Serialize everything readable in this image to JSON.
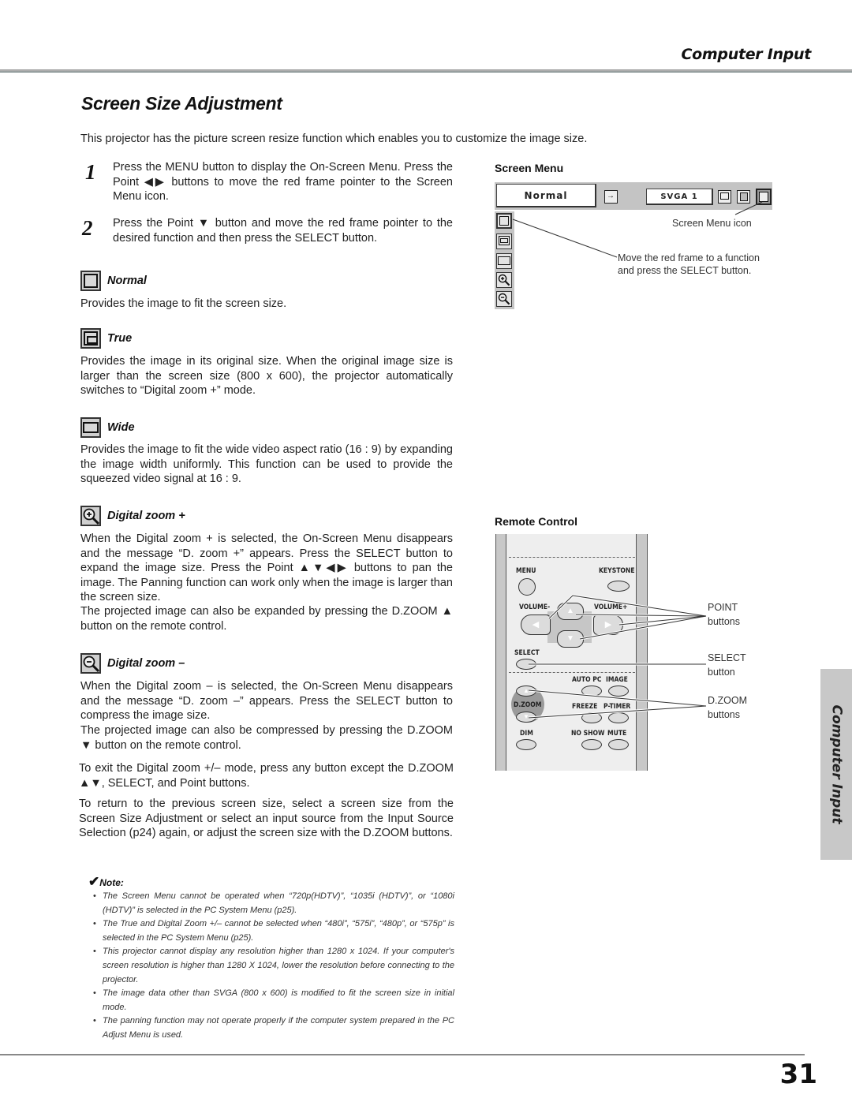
{
  "header": {
    "section": "Computer Input"
  },
  "page": {
    "title": "Screen Size Adjustment",
    "number": "31"
  },
  "intro": "This projector has the picture screen resize function which enables you to customize the image size.",
  "steps": [
    {
      "num": "1",
      "text": "Press the MENU button to display the On-Screen Menu. Press the Point ◀▶ buttons to move the red frame pointer to the Screen Menu icon."
    },
    {
      "num": "2",
      "text": "Press the Point ▼ button and move the red frame pointer to the desired function and then press the SELECT button."
    }
  ],
  "sections": [
    {
      "icon": "normal-screen-icon",
      "label": "Normal",
      "text": "Provides the image to fit the screen size."
    },
    {
      "icon": "true-screen-icon",
      "label": "True",
      "text": "Provides the image in its original size. When the original image size is larger than the screen size (800 x 600), the projector automatically switches to “Digital zoom +” mode."
    },
    {
      "icon": "wide-screen-icon",
      "label": "Wide",
      "text": "Provides the image to fit the wide video aspect ratio (16 : 9) by expanding the image width uniformly. This function can be used to provide the squeezed video signal at 16 : 9."
    },
    {
      "icon": "zoom-in-icon",
      "label": "Digital zoom +",
      "text": "When the Digital zoom + is selected, the On-Screen Menu disappears and the message “D. zoom +” appears. Press the SELECT button to expand the image size.  Press the Point ▲▼◀▶ buttons to pan the image. The Panning function can work only when the image is larger than the screen size.",
      "text2": "The projected image can also be expanded by pressing the D.ZOOM ▲ button on the remote control."
    },
    {
      "icon": "zoom-out-icon",
      "label": "Digital zoom –",
      "text": "When the Digital zoom – is selected, the On-Screen Menu disappears and the message “D. zoom –” appears. Press the SELECT button to compress the image size.",
      "text2": "The projected image can also be compressed by pressing the D.ZOOM ▼ button on the remote control."
    }
  ],
  "exit_text": "To exit the Digital zoom +/– mode, press any button except the D.ZOOM ▲▼, SELECT, and Point buttons.",
  "return_text": "To return to the previous screen size, select a screen size from the Screen Size Adjustment or select an input source from the Input Source Selection (p24) again, or adjust the screen size with the D.ZOOM buttons.",
  "note": {
    "title": "Note:",
    "items": [
      "The Screen Menu cannot be operated when “720p(HDTV)”, “1035i (HDTV)”, or “1080i (HDTV)” is selected in the PC System Menu (p25).",
      "The True and Digital Zoom +/– cannot be selected when “480i”, “575i”, “480p”, or “575p” is selected in the PC System Menu (p25).",
      "This projector cannot display any resolution higher than 1280 x 1024. If your computer's screen resolution is higher than 1280 X 1024, lower the resolution before connecting to the projector.",
      "The image data other than SVGA (800 x 600) is modified to fit the screen size in initial mode.",
      "The panning function may not operate properly if the computer system prepared in the PC Adjust Menu is used."
    ]
  },
  "screen_menu": {
    "heading": "Screen Menu",
    "mode_value": "Normal",
    "signal_value": "SVGA 1",
    "caption_icon": "Screen Menu icon",
    "caption_move": "Move the red frame to a function and press the SELECT button."
  },
  "remote": {
    "heading": "Remote Control",
    "buttons": {
      "menu": "MENU",
      "keystone": "KEYSTONE",
      "vol_minus": "VOLUME-",
      "vol_plus": "VOLUME+",
      "select": "SELECT",
      "autopc": "AUTO PC",
      "image": "IMAGE",
      "dzoom": "D.ZOOM",
      "freeze": "FREEZE",
      "ptimer": "P-TIMER",
      "dim": "DIM",
      "noshow": "NO SHOW",
      "mute": "MUTE"
    },
    "callouts": {
      "point_1": "POINT",
      "point_2": "buttons",
      "select_1": "SELECT",
      "select_2": "button",
      "dzoom_1": "D.ZOOM",
      "dzoom_2": "buttons"
    }
  },
  "side_tab": "Computer Input"
}
